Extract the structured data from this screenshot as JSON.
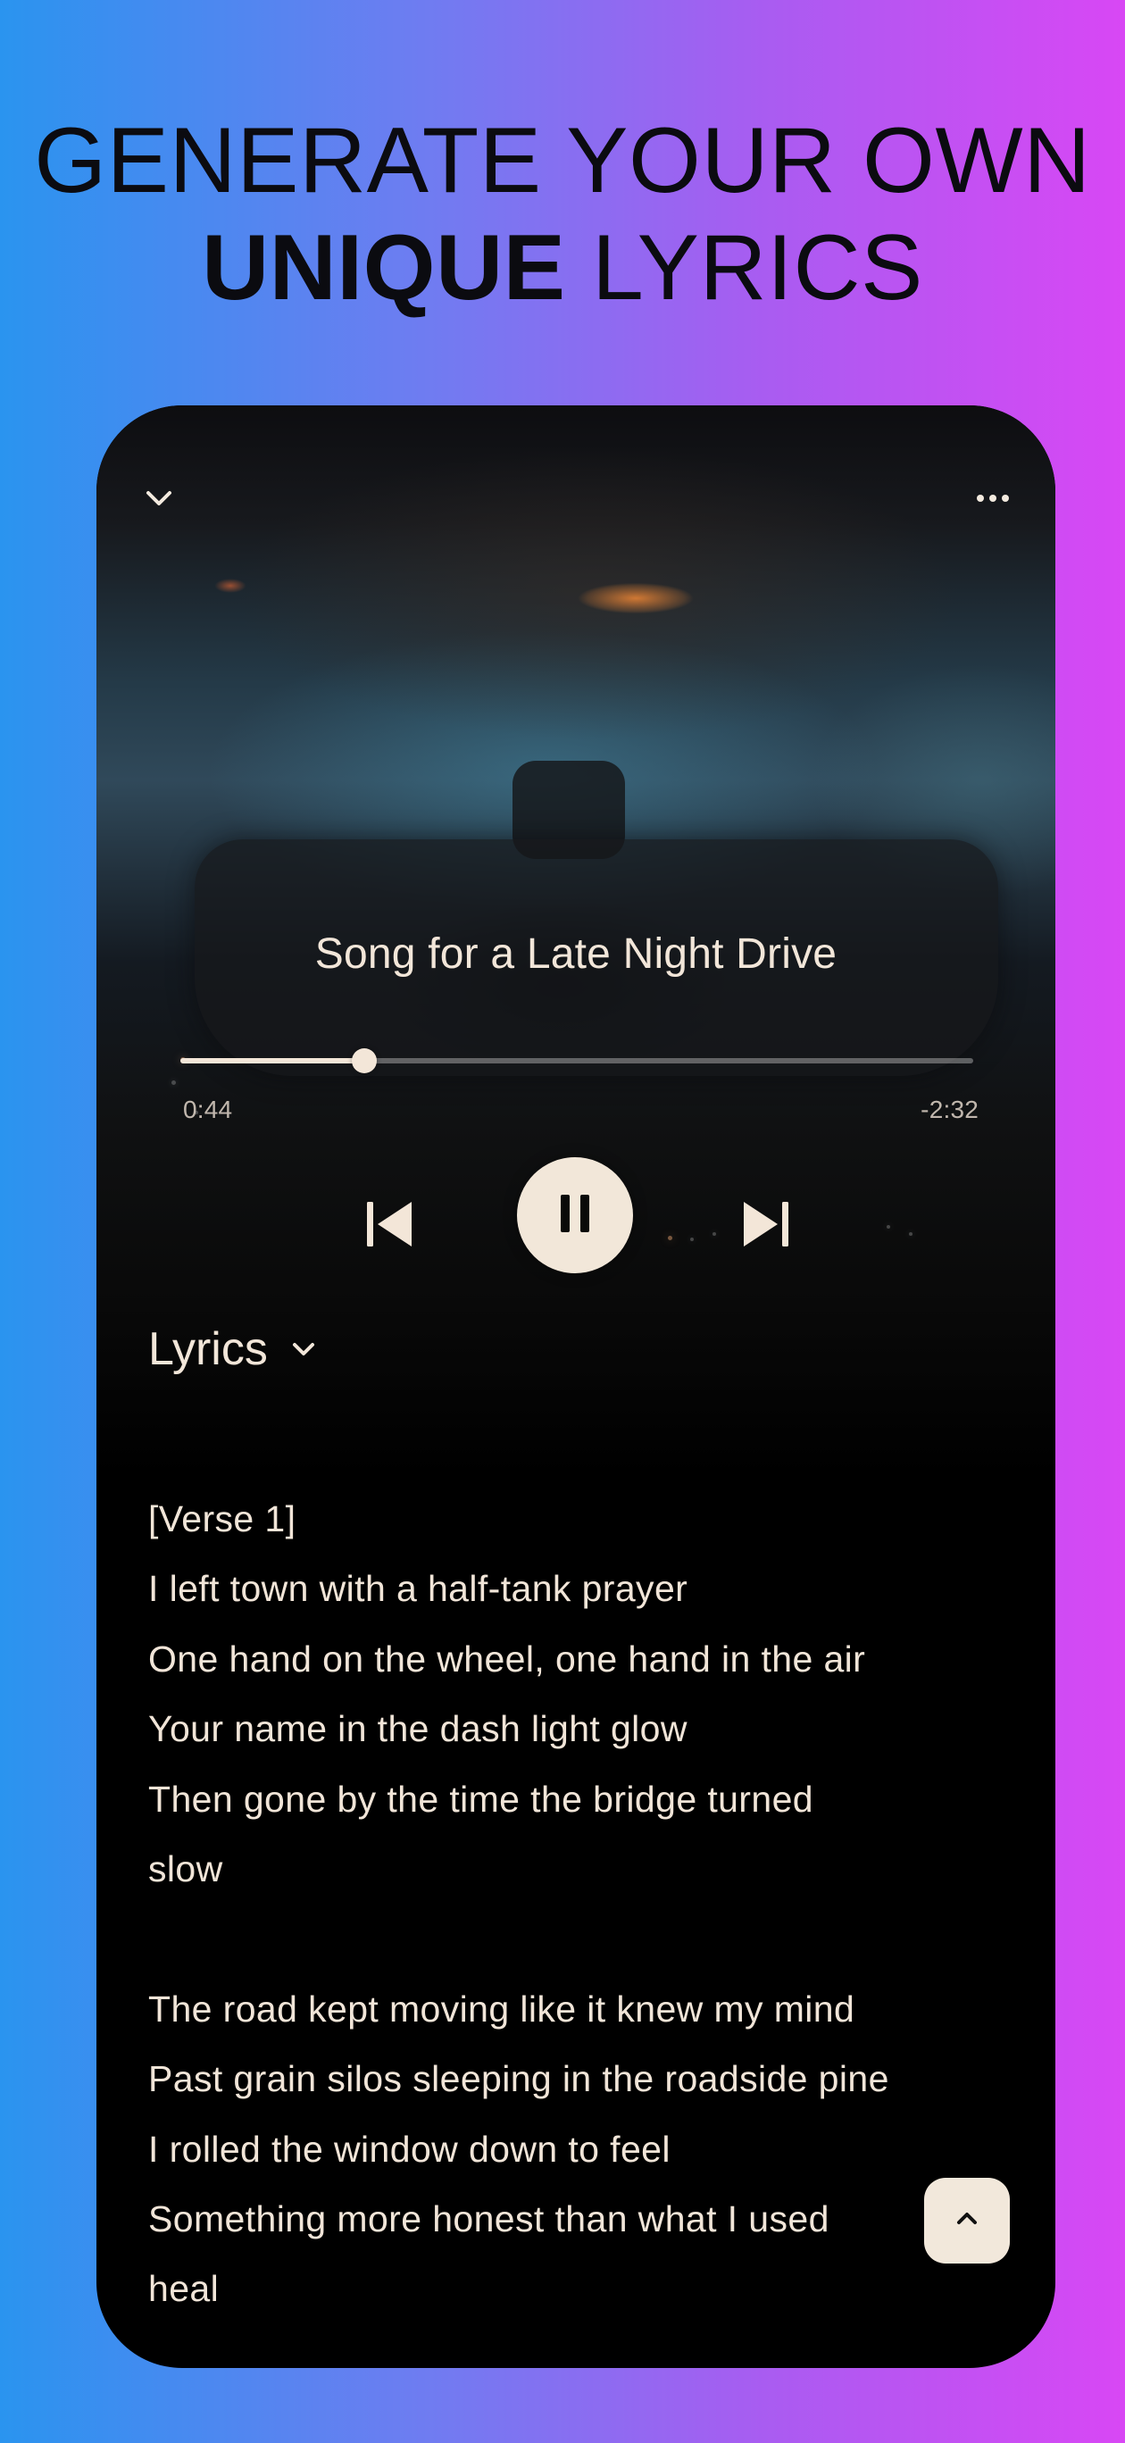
{
  "promo": {
    "headline_line1": "GENERATE YOUR OWN",
    "headline_strong": "UNIQUE",
    "headline_rest": "LYRICS"
  },
  "player": {
    "title": "Song for a Late Night Drive",
    "elapsed": "0:44",
    "remaining": "-2:32",
    "progress_fraction": 0.2315,
    "top_left_icon": "chevron-down-icon",
    "top_right_icon": "more-icon",
    "controls": {
      "previous_icon": "skip-previous-icon",
      "play_pause_icon": "pause-icon",
      "next_icon": "skip-next-icon"
    }
  },
  "lyrics": {
    "toggle_label": "Lyrics",
    "toggle_icon": "chevron-down-icon",
    "lines": [
      "[Verse 1]",
      "I left town with a half-tank prayer",
      "One hand on the wheel, one hand in the air",
      "Your name in the dash light glow",
      "Then gone by the time the bridge turned",
      "slow",
      "",
      "The road kept moving like it knew my mind",
      "Past grain silos sleeping in the roadside pine",
      "I rolled the window down to feel",
      "Something more honest than what I used",
      "heal"
    ]
  },
  "scroll_top_icon": "chevron-up-icon",
  "colors": {
    "gradient_left": "#2a94ef",
    "gradient_mid": "#a95cf1",
    "gradient_right": "#d847f4",
    "accent_cream": "#f2e7d9",
    "dark": "#000000"
  }
}
